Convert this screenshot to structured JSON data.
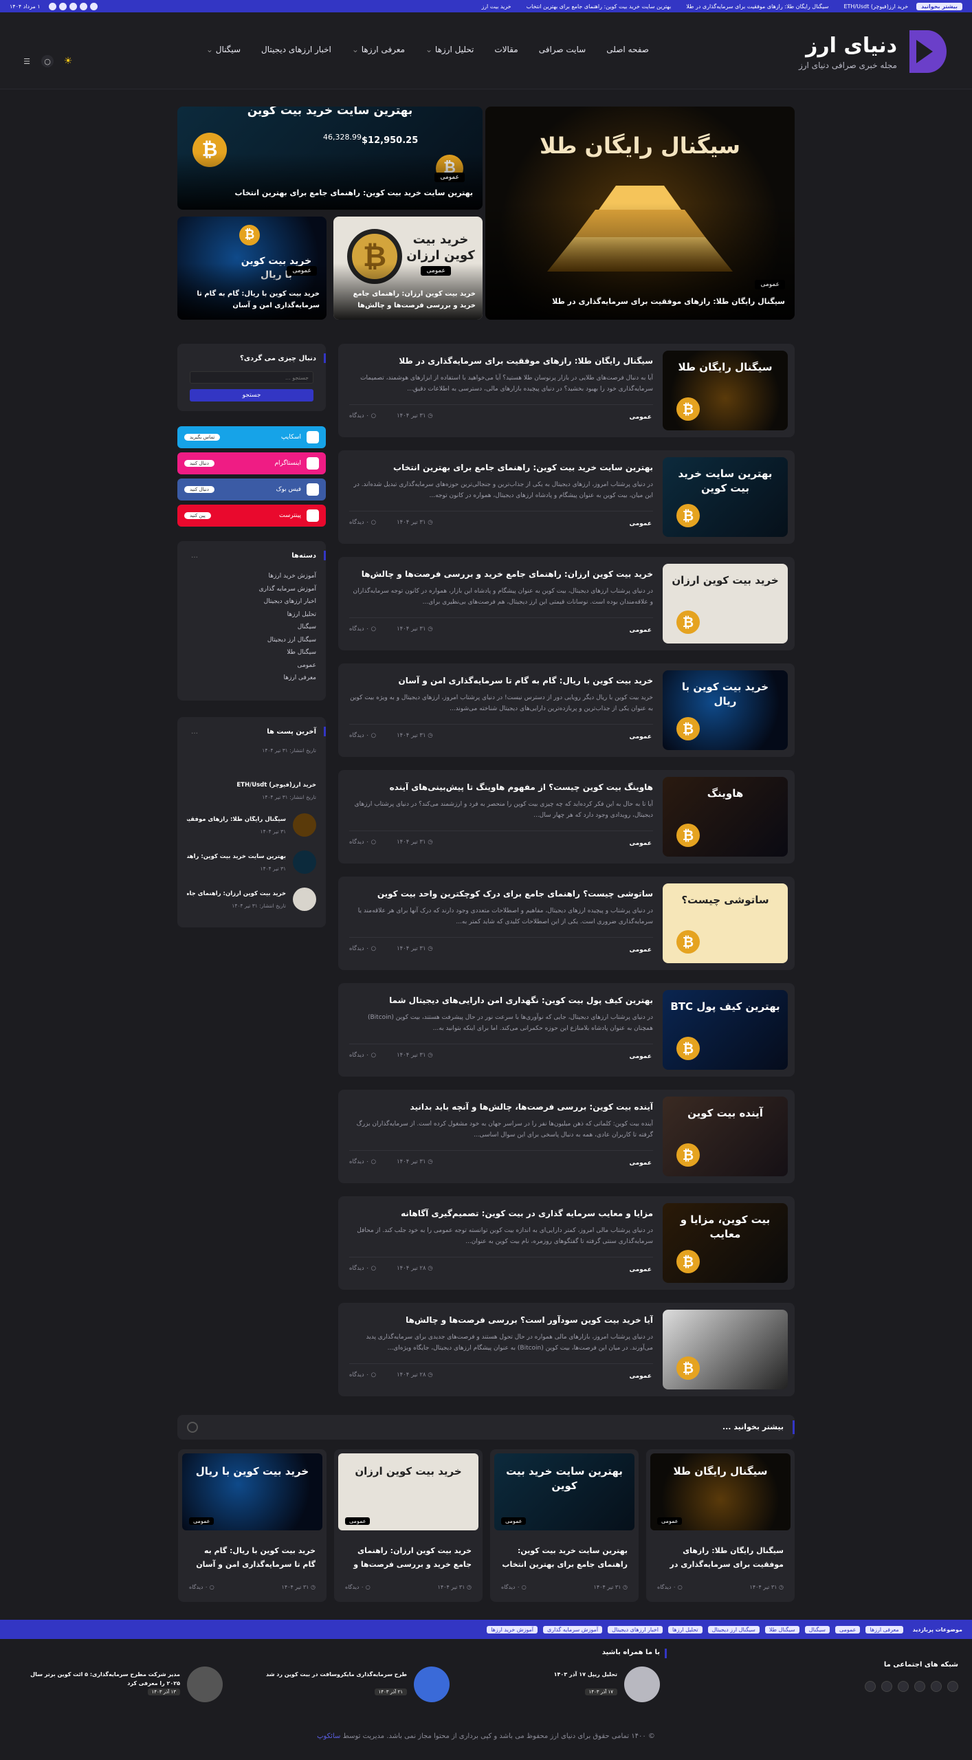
{
  "topbar": {
    "tag": "بیشتر بخوانید",
    "ticker": [
      "خرید ارز(فیوچر) ETH/Usdt",
      "سیگنال رایگان طلا: رازهای موفقیت برای سرمایه‌گذاری در طلا",
      "بهترین سایت خرید بیت کوین: راهنمای جامع برای بهترین انتخاب",
      "خرید بیت ارز"
    ],
    "date": "۱ مرداد ۱۴۰۴"
  },
  "logo": {
    "title": "دنیای ارز",
    "subtitle": "مجله خبری صرافی دنیای ارز"
  },
  "nav": [
    "صفحه اصلی",
    "سایت صرافی",
    "مقالات",
    "تحلیل ارزها",
    "معرفی ارزها",
    "اخبار ارزهای دیجیتال",
    "سیگنال"
  ],
  "hero": {
    "main": {
      "cat": "عمومی",
      "title": "سیگنال رایگان طلا: رازهای موفقیت برای سرمایه‌گذاری در طلا",
      "art": "سیگنال رایگان طلا"
    },
    "top": {
      "cat": "عمومی",
      "title": "بهترین سایت خرید بیت کوین: راهنمای جامع برای بهترین انتخاب",
      "art": "بهترین سایت خرید بیت کوین",
      "price1": "46,328.99",
      "price2": "$12,950.25"
    },
    "s1": {
      "cat": "عمومی",
      "title": "خرید بیت کوین ارزان: راهنمای جامع خرید و بررسی فرصت‌ها و چالش‌ها",
      "art": "خرید بیت کوین ارزان"
    },
    "s2": {
      "cat": "عمومی",
      "title": "خرید بیت کوین با ریال: گام به گام تا سرمایه‌گذاری امن و آسان",
      "art": "خرید بیت کوین با ریال"
    }
  },
  "posts": [
    {
      "title": "سیگنال رایگان طلا: رازهای موفقیت برای سرمایه‌گذاری در طلا",
      "excerpt": "آیا به دنبال فرصت‌های طلایی در بازار پرنوسان طلا هستید؟ آیا می‌خواهید با استفاده از ابزارهای هوشمند، تصمیمات سرمایه‌گذاری خود را بهبود بخشید؟ در دنیای پیچیده بازارهای مالی، دسترسی به اطلاعات دقیق...",
      "cat": "عمومی",
      "date": "۳۱ تیر ۱۴۰۴",
      "views": "۰ دیدگاه",
      "art": "سیگنال رایگان طلا"
    },
    {
      "title": "بهترین سایت خرید بیت کوین: راهنمای جامع برای بهترین انتخاب",
      "excerpt": "در دنیای پرشتاب امروز، ارزهای دیجیتال به یکی از جذاب‌ترین و جنجالی‌ترین حوزه‌های سرمایه‌گذاری تبدیل شده‌اند. در این میان، بیت کوین به عنوان پیشگام و پادشاه ارزهای دیجیتال، همواره در کانون توجه...",
      "cat": "عمومی",
      "date": "۳۱ تیر ۱۴۰۴",
      "views": "۰ دیدگاه",
      "art": "بهترین سایت خرید بیت کوین"
    },
    {
      "title": "خرید بیت کوین ارزان: راهنمای جامع خرید و بررسی فرصت‌ها و چالش‌ها",
      "excerpt": "در دنیای پرشتاب ارزهای دیجیتال، بیت کوین به عنوان پیشگام و پادشاه این بازار، همواره در کانون توجه سرمایه‌گذاران و علاقه‌مندان بوده است. نوسانات قیمتی این ارز دیجیتال، هم فرصت‌های بی‌نظیری برای...",
      "cat": "عمومی",
      "date": "۳۱ تیر ۱۴۰۴",
      "views": "۰ دیدگاه",
      "art": "خرید بیت کوین ارزان"
    },
    {
      "title": "خرید بیت کوین با ریال: گام به گام تا سرمایه‌گذاری امن و آسان",
      "excerpt": "خرید بیت کوین با ریال دیگر رویایی دور از دسترس نیست! در دنیای پرشتاب امروز، ارزهای دیجیتال و به ویژه بیت کوین به عنوان یکی از جذاب‌ترین و پربازده‌ترین دارایی‌های دیجیتال شناخته می‌شوند...",
      "cat": "عمومی",
      "date": "۳۱ تیر ۱۴۰۴",
      "views": "۰ دیدگاه",
      "art": "خرید بیت کوین با ریال"
    },
    {
      "title": "هاوینگ بیت کوین چیست؟ از مفهوم هاوینگ تا پیش‌بینی‌های آینده",
      "excerpt": "آیا تا به حال به این فکر کرده‌اید که چه چیزی بیت کوین را منحصر به فرد و ارزشمند می‌کند؟ در دنیای پرشتاب ارزهای دیجیتال، رویدادی وجود دارد که هر چهار سال...",
      "cat": "عمومی",
      "date": "۳۱ تیر ۱۴۰۴",
      "views": "۰ دیدگاه",
      "art": "هاوینگ"
    },
    {
      "title": "ساتوشی چیست؟ راهنمای جامع برای درک کوچکترین واحد بیت کوین",
      "excerpt": "در دنیای پرشتاب و پیچیده ارزهای دیجیتال، مفاهیم و اصطلاحات متعددی وجود دارند که درک آنها برای هر علاقه‌مند یا سرمایه‌گذاری ضروری است. یکی از این اصطلاحات کلیدی که شاید کمتر به...",
      "cat": "عمومی",
      "date": "۳۱ تیر ۱۴۰۴",
      "views": "۰ دیدگاه",
      "art": "ساتوشی چیست؟"
    },
    {
      "title": "بهترین کیف پول بیت کوین: نگهداری امن دارایی‌های دیجیتال شما",
      "excerpt": "در دنیای پرشتاب ارزهای دیجیتال، جایی که نوآوری‌ها با سرعت نور در حال پیشرفت هستند، بیت کوین (Bitcoin) همچنان به عنوان پادشاه بلامنازع این حوزه حکمرانی می‌کند. اما برای اینکه بتوانید به...",
      "cat": "عمومی",
      "date": "۳۱ تیر ۱۴۰۴",
      "views": "۰ دیدگاه",
      "art": "بهترین کیف پول BTC"
    },
    {
      "title": "آینده بیت کوین: بررسی فرصت‌ها، چالش‌ها و آنچه باید بدانید",
      "excerpt": "آینده بیت کوین: کلماتی که ذهن میلیون‌ها نفر را در سراسر جهان به خود مشغول کرده است. از سرمایه‌گذاران بزرگ گرفته تا کاربران عادی، همه به دنبال پاسخی برای این سوال اساسی...",
      "cat": "عمومی",
      "date": "۳۱ تیر ۱۴۰۴",
      "views": "۰ دیدگاه",
      "art": "آینده بیت کوین"
    },
    {
      "title": "مزایا و معایب سرمایه گذاری در بیت کوین: تصمیم‌گیری آگاهانه",
      "excerpt": "در دنیای پرشتاب مالی امروز، کمتر دارایی‌ای به اندازه بیت کوین توانسته توجه عمومی را به خود جلب کند. از محافل سرمایه‌گذاری سنتی گرفته تا گفتگوهای روزمره، نام بیت کوین به عنوان...",
      "cat": "عمومی",
      "date": "۲۸ تیر ۱۴۰۴",
      "views": "۰ دیدگاه",
      "art": "بیت کوین، مزایا و معایب"
    },
    {
      "title": "آیا خرید بیت کوین سودآور است؟ بررسی فرصت‌ها و چالش‌ها",
      "excerpt": "در دنیای پرشتاب امروز، بازارهای مالی همواره در حال تحول هستند و فرصت‌های جدیدی برای سرمایه‌گذاری پدید می‌آورند. در میان این فرصت‌ها، بیت کوین (Bitcoin) به عنوان پیشگام ارزهای دیجیتال، جایگاه ویژه‌ای...",
      "cat": "عمومی",
      "date": "۲۸ تیر ۱۴۰۴",
      "views": "۰ دیدگاه",
      "art": ""
    }
  ],
  "sidebar": {
    "search": {
      "title": "دنبال چیزی می گردی؟",
      "placeholder": "جستجو ...",
      "button": "جستجو"
    },
    "social": [
      {
        "name": "اسکایپ",
        "pill": "تماس بگیرید",
        "color": "#16a3e8"
      },
      {
        "name": "اینستاگرام",
        "pill": "دنبال کنید",
        "color": "#ef1c84"
      },
      {
        "name": "فیس بوک",
        "pill": "دنبال کنید",
        "color": "#3b5ba5"
      },
      {
        "name": "پینترست",
        "pill": "پین کنید",
        "color": "#e9092d"
      }
    ],
    "categories": {
      "title": "دسته‌ها",
      "items": [
        "آموزش خرید ارزها",
        "آموزش سرمایه گذاری",
        "اخبار ارزهای دیجیتال",
        "تحلیل ارزها",
        "سیگنال",
        "سیگنال ارز دیجیتال",
        "سیگنال طلا",
        "عمومی",
        "معرفی ارزها"
      ]
    },
    "latest": {
      "title": "آخرین پست ها",
      "first_date": "تاریخ انتشار: ۳۱ تیر ۱۴۰۴",
      "items": [
        {
          "title": "خرید ارز(فیوچر) ETH/Usdt",
          "date": "تاریخ انتشار: ۳۱ تیر ۱۴۰۴"
        },
        {
          "title": "سیگنال رایگان طلا: رازهای موفقیت ...",
          "date": "۳۱ تیر ۱۴۰۴"
        },
        {
          "title": "بهترین سایت خرید بیت کوین: راهنما...",
          "date": "۳۱ تیر ۱۴۰۴"
        },
        {
          "title": "خرید بیت کوین ارزان: راهنمای جامع...",
          "date": "تاریخ انتشار: ۳۱ تیر ۱۴۰۴"
        }
      ]
    }
  },
  "more": {
    "title": "بیشتر بخوانید ...",
    "items": [
      {
        "title": "سیگنال رایگان طلا: رازهای موفقیت برای سرمایه‌گذاری در طلا",
        "date": "۳۱ تیر ۱۴۰۴",
        "views": "۰ دیدگاه",
        "cat": "عمومی",
        "art": "سیگنال رایگان طلا"
      },
      {
        "title": "بهترین سایت خرید بیت کوین: راهنمای جامع برای بهترین انتخاب",
        "date": "۳۱ تیر ۱۴۰۴",
        "views": "۰ دیدگاه",
        "cat": "عمومی",
        "art": "بهترین سایت خرید بیت کوین"
      },
      {
        "title": "خرید بیت کوین ارزان: راهنمای جامع خرید و بررسی فرصت‌ها و چالش‌ها",
        "date": "۳۱ تیر ۱۴۰۴",
        "views": "۰ دیدگاه",
        "cat": "عمومی",
        "art": "خرید بیت کوین ارزان"
      },
      {
        "title": "خرید بیت کوین با ریال: گام به گام تا سرمایه‌گذاری امن و آسان",
        "date": "۳۱ تیر ۱۴۰۴",
        "views": "۰ دیدگاه",
        "cat": "عمومی",
        "art": "خرید بیت کوین با ریال"
      }
    ]
  },
  "tagbar": {
    "label": "موضوعات پربازدید",
    "tags": [
      "معرفی ارزها",
      "عمومی",
      "سیگنال",
      "سیگنال طلا",
      "سیگنال ارز دیجیتال",
      "تحلیل ارزها",
      "اخبار ارزهای دیجیتال",
      "آموزش سرمایه گذاری",
      "آموزش خرید ارزها"
    ]
  },
  "footer": {
    "social_title": "شبکه های اجتماعی ما",
    "withus": "با ما همراه باشید",
    "items": [
      {
        "title": "تحلیل ریپل ۱۷ آذر ۱۴۰۳",
        "date": "۱۷ آذر ۱۴۰۳"
      },
      {
        "title": "طرح سرمایه‌گذاری مایکروسافت در بیت کوین رد شد",
        "date": "۲۱ آذر ۱۴۰۳"
      },
      {
        "title": "مدیر شرکت مطرح سرمایه‌گذاری: ۵ ائت کوین برتر سال ۲۰۲۵ را معرفی کرد",
        "date": "۱۳ آذر ۱۴۰۳"
      }
    ],
    "copyright": "© ۱۴۰۰ تمامی حقوق برای دنیای ارز محفوظ می باشد و کپی برداری از محتوا مجاز نمی باشد. مدیریت توسط",
    "brand": "سائکوپ"
  },
  "colors": {
    "accent": "#3336c4",
    "bg": "#1c1c20",
    "card": "#26262b",
    "gold": "#d9a22a"
  }
}
